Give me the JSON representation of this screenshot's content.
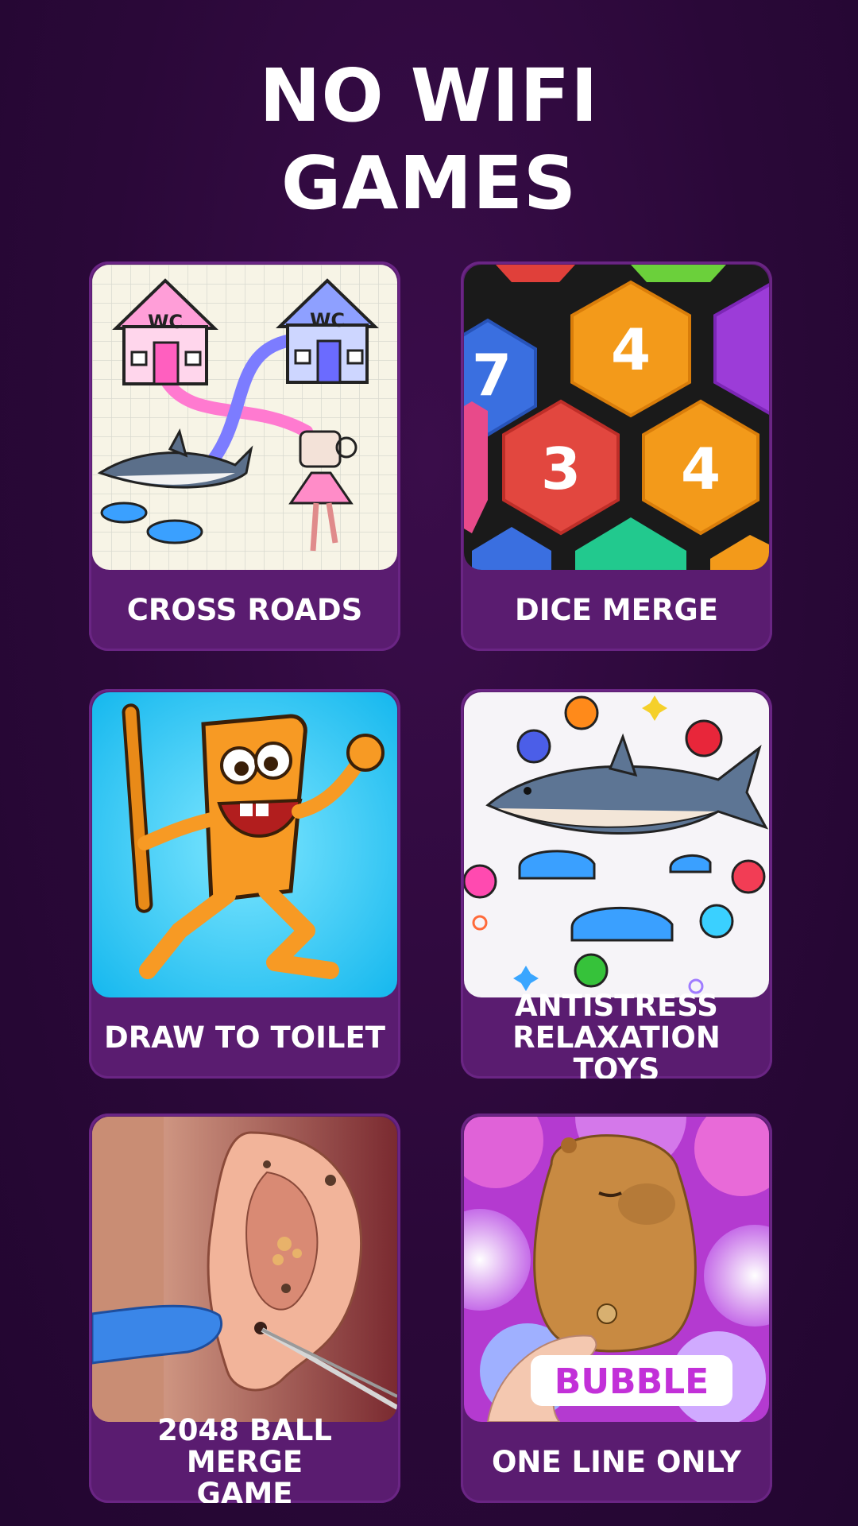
{
  "header": {
    "title_line1": "NO WIFI",
    "title_line2": "GAMES"
  },
  "games": [
    {
      "label": "CROSS ROADS",
      "icon": "wc-houses-shark-cup-icon"
    },
    {
      "label": "DICE MERGE",
      "icon": "hexagon-numbers-icon",
      "tiles": [
        "7",
        "4",
        "3",
        "4"
      ]
    },
    {
      "label": "DRAW TO TOILET",
      "icon": "wooden-stick-man-icon"
    },
    {
      "label": "ANTISTRESS\nRELAXATION TOYS",
      "icon": "shark-sneakers-balls-icon"
    },
    {
      "label": "2048 BALL MERGE\nGAME",
      "icon": "ear-cleaning-icon"
    },
    {
      "label": "ONE LINE ONLY",
      "icon": "capybara-bubble-icon",
      "sign_text": "BUBBLE"
    }
  ],
  "colors": {
    "background": "#2a0838",
    "card": "#5a1c70",
    "text": "#ffffff"
  }
}
